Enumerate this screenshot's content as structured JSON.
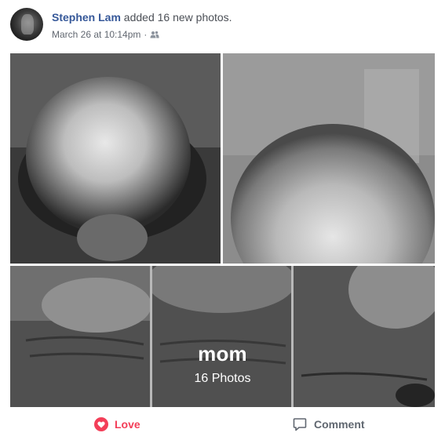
{
  "post": {
    "author_name": "Stephen Lam",
    "action_text": "added 16 new photos.",
    "timestamp": "March 26 at 10:14pm",
    "separator": "·",
    "audience_icon": "friends-icon"
  },
  "album": {
    "title": "mom",
    "photo_count_label": "16 Photos"
  },
  "actions": {
    "love_label": "Love",
    "comment_label": "Comment"
  },
  "colors": {
    "author_link": "#365899",
    "love_red": "#f33e58",
    "meta_gray": "#616770"
  }
}
